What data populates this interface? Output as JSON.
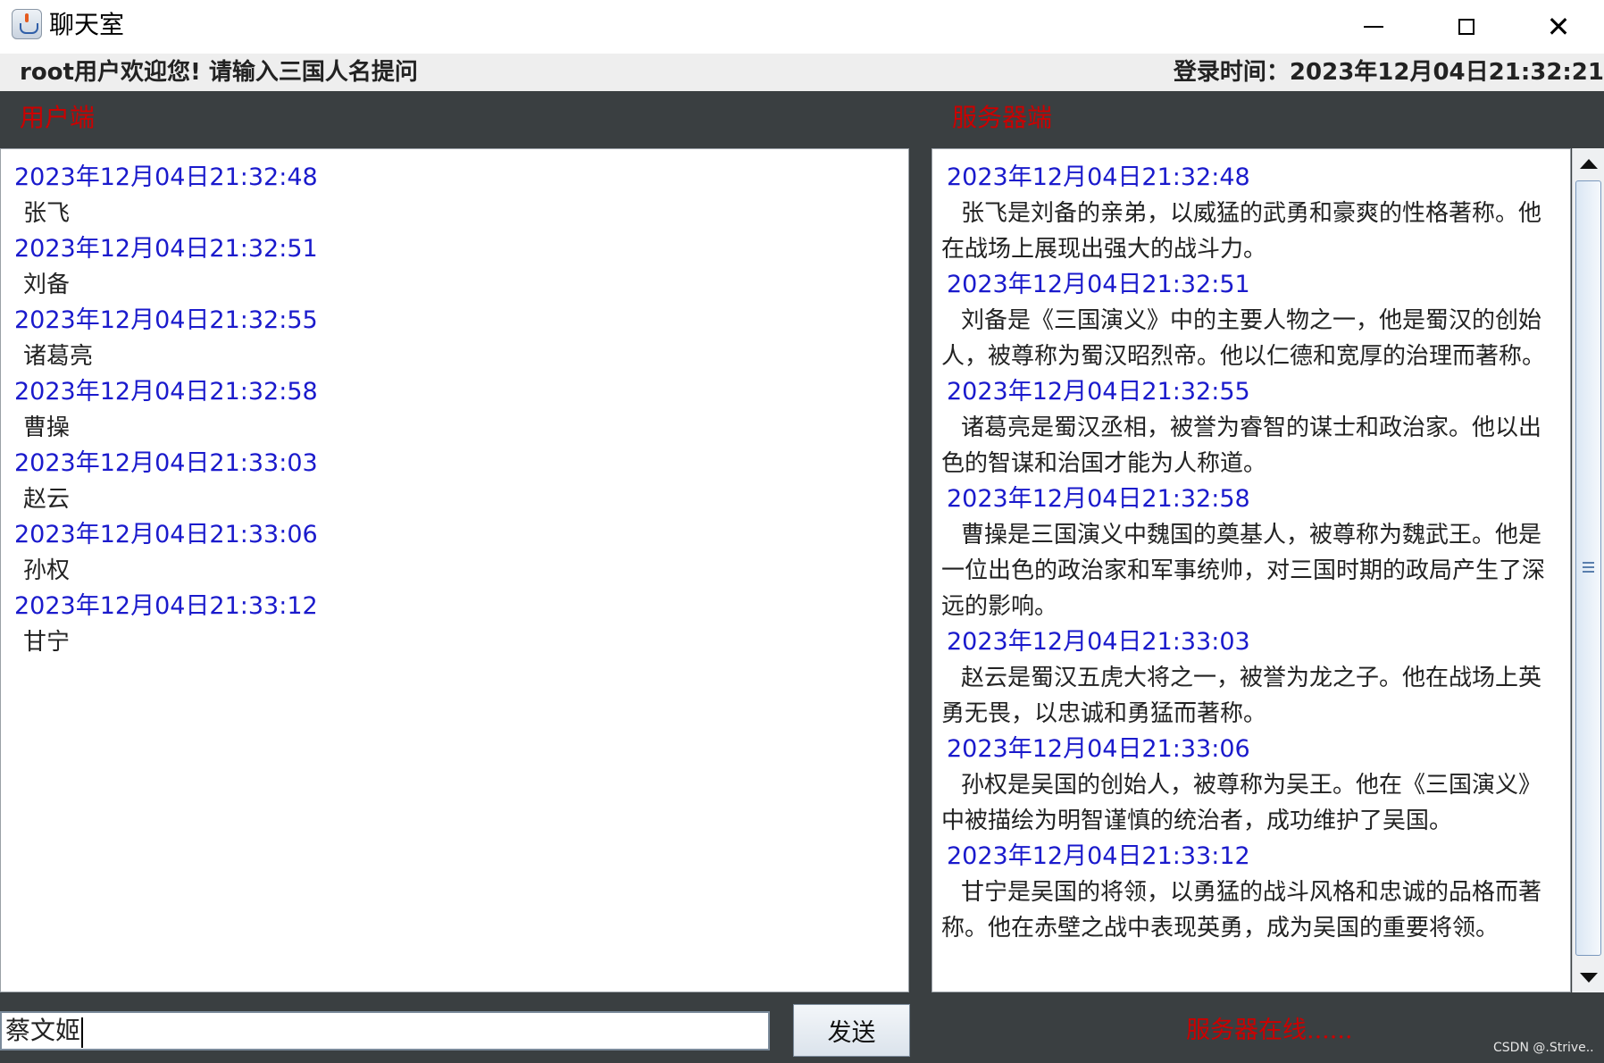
{
  "window": {
    "title": "聊天室",
    "controls": [
      "minimize",
      "maximize",
      "close"
    ],
    "close_glyph": "✕"
  },
  "header": {
    "welcome": "root用户欢迎您! 请输入三国人名提问",
    "login_label": "登录时间：",
    "login_time": "2023年12月04日21:32:21"
  },
  "client": {
    "label": "用户端",
    "messages": [
      {
        "time": "2023年12月04日21:32:48",
        "text": "张飞"
      },
      {
        "time": "2023年12月04日21:32:51",
        "text": "刘备"
      },
      {
        "time": "2023年12月04日21:32:55",
        "text": "诸葛亮"
      },
      {
        "time": "2023年12月04日21:32:58",
        "text": "曹操"
      },
      {
        "time": "2023年12月04日21:33:03",
        "text": "赵云"
      },
      {
        "time": "2023年12月04日21:33:06",
        "text": "孙权"
      },
      {
        "time": "2023年12月04日21:33:12",
        "text": "甘宁"
      }
    ]
  },
  "server": {
    "label": "服务器端",
    "messages": [
      {
        "time": "2023年12月04日21:32:48",
        "text": "张飞是刘备的亲弟，以威猛的武勇和豪爽的性格著称。他在战场上展现出强大的战斗力。"
      },
      {
        "time": "2023年12月04日21:32:51",
        "text": "刘备是《三国演义》中的主要人物之一，他是蜀汉的创始人，被尊称为蜀汉昭烈帝。他以仁德和宽厚的治理而著称。"
      },
      {
        "time": "2023年12月04日21:32:55",
        "text": "诸葛亮是蜀汉丞相，被誉为睿智的谋士和政治家。他以出色的智谋和治国才能为人称道。"
      },
      {
        "time": "2023年12月04日21:32:58",
        "text": "曹操是三国演义中魏国的奠基人，被尊称为魏武王。他是一位出色的政治家和军事统帅，对三国时期的政局产生了深远的影响。"
      },
      {
        "time": "2023年12月04日21:33:03",
        "text": "赵云是蜀汉五虎大将之一，被誉为龙之子。他在战场上英勇无畏，以忠诚和勇猛而著称。"
      },
      {
        "time": "2023年12月04日21:33:06",
        "text": "孙权是吴国的创始人，被尊称为吴王。他在《三国演义》中被描绘为明智谨慎的统治者，成功维护了吴国。"
      },
      {
        "time": "2023年12月04日21:33:12",
        "text": "甘宁是吴国的将领，以勇猛的战斗风格和忠诚的品格而著称。他在赤壁之战中表现英勇，成为吴国的重要将领。"
      }
    ],
    "status": "服务器在线......"
  },
  "input": {
    "value": "蔡文姬"
  },
  "send_button": {
    "label": "发送"
  },
  "watermark": "CSDN @.Strive..",
  "colors": {
    "frame": "#3a3f41",
    "label_red": "#cc0000",
    "timestamp_blue": "#1a1acc"
  }
}
